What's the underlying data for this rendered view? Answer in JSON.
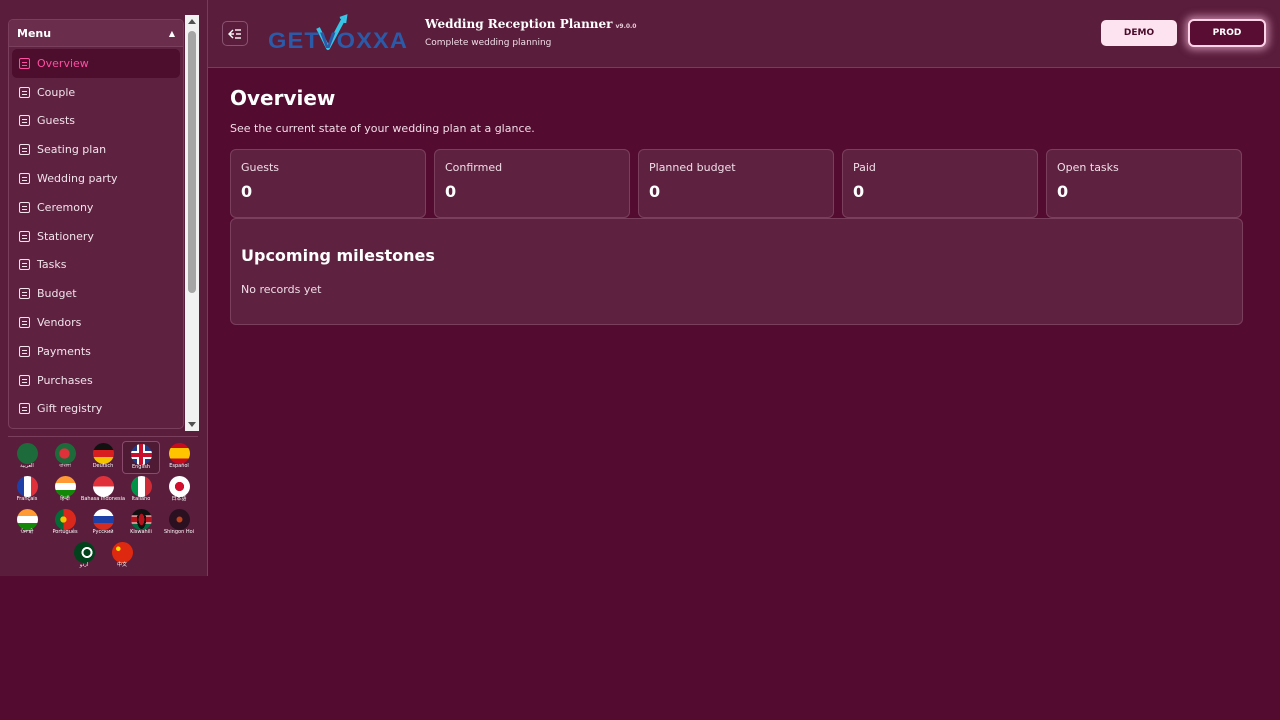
{
  "colors": {
    "background": "#540b30",
    "panel": "#5e2240",
    "active_accent": "#ff4fa3",
    "demo_button": "#fde3f0",
    "prod_glow": "#ffd3e8"
  },
  "sidebar": {
    "menu_title": "Menu",
    "menu_items": [
      {
        "label": "Overview",
        "active": true
      },
      {
        "label": "Couple"
      },
      {
        "label": "Guests"
      },
      {
        "label": "Seating plan"
      },
      {
        "label": "Wedding party"
      },
      {
        "label": "Ceremony"
      },
      {
        "label": "Stationery"
      },
      {
        "label": "Tasks"
      },
      {
        "label": "Budget"
      },
      {
        "label": "Vendors"
      },
      {
        "label": "Payments"
      },
      {
        "label": "Purchases"
      },
      {
        "label": "Gift registry"
      }
    ],
    "languages": [
      {
        "label": "العربية",
        "icon": "flag-saudi-arabia-icon"
      },
      {
        "label": "বাংলা",
        "icon": "flag-bangladesh-icon"
      },
      {
        "label": "Deutsch",
        "icon": "flag-germany-icon"
      },
      {
        "label": "English",
        "icon": "flag-uk-icon",
        "selected": true
      },
      {
        "label": "Español",
        "icon": "flag-spain-icon"
      },
      {
        "label": "Français",
        "icon": "flag-france-icon"
      },
      {
        "label": "हिन्दी",
        "icon": "flag-india-icon"
      },
      {
        "label": "Bahasa Indonesia",
        "icon": "flag-indonesia-icon"
      },
      {
        "label": "Italiano",
        "icon": "flag-italy-icon"
      },
      {
        "label": "日本語",
        "icon": "flag-japan-icon"
      },
      {
        "label": "ਪੰਜਾਬੀ",
        "icon": "flag-india-icon"
      },
      {
        "label": "Português",
        "icon": "flag-portugal-icon"
      },
      {
        "label": "Русский",
        "icon": "flag-russia-icon"
      },
      {
        "label": "Kiswahili",
        "icon": "flag-kenya-icon"
      },
      {
        "label": "Shingon Hoi",
        "icon": "flag-dark-emblem-icon"
      },
      {
        "label": "اردو",
        "icon": "flag-pakistan-icon"
      },
      {
        "label": "中文",
        "icon": "flag-china-icon"
      }
    ]
  },
  "header": {
    "logo_text": "GETVOXXA",
    "app_title": "Wedding Reception Planner",
    "version": "v9.0.0",
    "subtitle": "Complete wedding planning",
    "demo_label": "DEMO",
    "prod_label": "PROD"
  },
  "overview": {
    "title": "Overview",
    "description": "See the current state of your wedding plan at a glance.",
    "stats": [
      {
        "label": "Guests",
        "value": "0"
      },
      {
        "label": "Confirmed",
        "value": "0"
      },
      {
        "label": "Planned budget",
        "value": "0"
      },
      {
        "label": "Paid",
        "value": "0"
      },
      {
        "label": "Open tasks",
        "value": "0"
      }
    ],
    "milestones_title": "Upcoming milestones",
    "milestones_empty": "No records yet"
  }
}
